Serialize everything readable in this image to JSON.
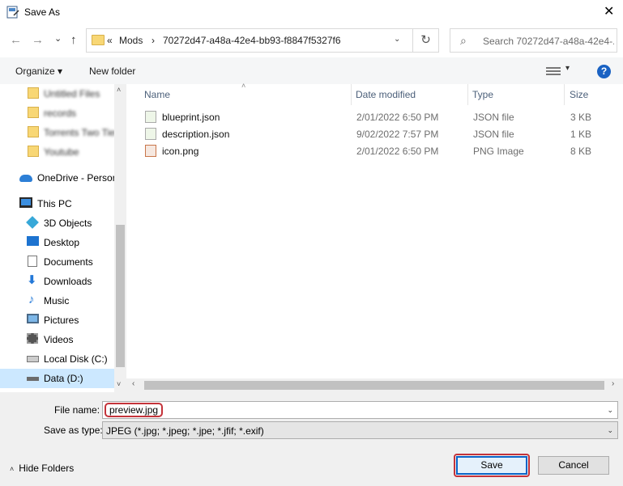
{
  "window": {
    "title": "Save As",
    "close_glyph": "✕",
    "app_icon": "save-as-dialog-icon"
  },
  "nav": {
    "back": "←",
    "forward": "→",
    "recent": "⌄",
    "up": "↑",
    "breadcrumb": [
      "«",
      "Mods",
      "›",
      "70272d47-a48a-42e4-bb93-f8847f5327f6"
    ],
    "chevron": "⌄",
    "refresh": "↻",
    "search_icon": "⌕",
    "search_placeholder": "Search 70272d47-a48a-42e4-..."
  },
  "toolbar": {
    "organize": "Organize ▾",
    "new_folder": "New folder",
    "view_chevron": "▾",
    "help": "?"
  },
  "sidebar": {
    "items": [
      {
        "label": "Untitled Files",
        "icon": "folder-icon",
        "blurred": true
      },
      {
        "label": "records",
        "icon": "folder-icon",
        "blurred": true
      },
      {
        "label": "Torrents Two Tier",
        "icon": "folder-icon",
        "blurred": true
      },
      {
        "label": "Youtube",
        "icon": "folder-icon",
        "blurred": true
      },
      {
        "label": "OneDrive - Person",
        "icon": "onedrive-icon"
      },
      {
        "label": "This PC",
        "icon": "this-pc-icon"
      },
      {
        "label": "3D Objects",
        "icon": "3d-objects-icon"
      },
      {
        "label": "Desktop",
        "icon": "desktop-icon"
      },
      {
        "label": "Documents",
        "icon": "documents-icon"
      },
      {
        "label": "Downloads",
        "icon": "downloads-icon"
      },
      {
        "label": "Music",
        "icon": "music-icon"
      },
      {
        "label": "Pictures",
        "icon": "pictures-icon"
      },
      {
        "label": "Videos",
        "icon": "videos-icon"
      },
      {
        "label": "Local Disk (C:)",
        "icon": "local-disk-icon"
      },
      {
        "label": "Data (D:)",
        "icon": "drive-icon",
        "selected": true
      }
    ]
  },
  "file_list": {
    "headers": {
      "name": "Name",
      "date": "Date modified",
      "type": "Type",
      "size": "Size"
    },
    "sort_glyph": "˄",
    "rows": [
      {
        "name": "blueprint.json",
        "date": "2/01/2022 6:50 PM",
        "type": "JSON file",
        "size": "3 KB",
        "icon": "json-file-icon"
      },
      {
        "name": "description.json",
        "date": "9/02/2022 7:57 PM",
        "type": "JSON file",
        "size": "1 KB",
        "icon": "json-file-icon"
      },
      {
        "name": "icon.png",
        "date": "2/01/2022 6:50 PM",
        "type": "PNG Image",
        "size": "8 KB",
        "icon": "png-file-icon"
      }
    ]
  },
  "scroll": {
    "up": "˄",
    "down": "˅",
    "left": "‹",
    "right": "›"
  },
  "form": {
    "file_name_label": "File name:",
    "file_name_value": "preview.jpg",
    "save_type_label": "Save as type:",
    "save_type_value": "JPEG (*.jpg; *.jpeg; *.jpe; *.jfif; *.exif)",
    "combo_chevron": "⌄"
  },
  "footer": {
    "hide_folders_chevron": "˄",
    "hide_folders": "Hide Folders",
    "save": "Save",
    "cancel": "Cancel"
  },
  "colors": {
    "accent": "#0a64c7",
    "highlight": "#c4333a",
    "selection": "#cce8ff",
    "folder": "#f8d775"
  }
}
